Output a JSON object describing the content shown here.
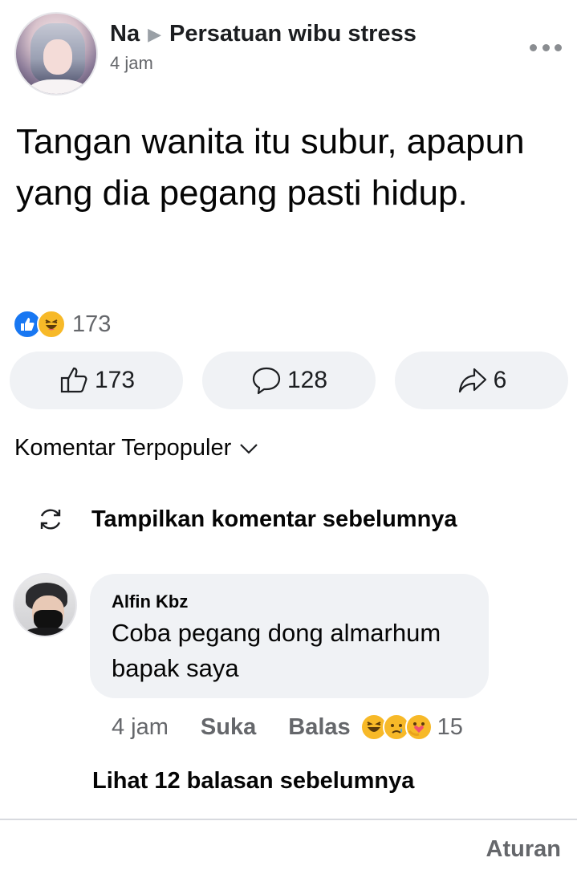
{
  "post": {
    "author": "Na",
    "group": "Persatuan wibu stress",
    "time": "4 jam",
    "text": "Tangan wanita itu subur, apapun yang dia pegang pasti hidup."
  },
  "reactions": {
    "icons": [
      "like-icon",
      "haha-icon"
    ],
    "total": "173"
  },
  "actions": {
    "like_count": "173",
    "comment_count": "128",
    "share_count": "6"
  },
  "comments": {
    "sort_label": "Komentar Terpopuler",
    "previous_label": "Tampilkan komentar sebelumnya",
    "items": [
      {
        "author": "Alfin Kbz",
        "text": "Coba pegang dong almarhum bapak saya",
        "time": "4 jam",
        "like_label": "Suka",
        "reply_label": "Balas",
        "reaction_icons": [
          "haha-icon",
          "sad-icon",
          "care-icon"
        ],
        "reaction_count": "15"
      }
    ],
    "more_replies_label": "Lihat 12 balasan sebelumnya"
  },
  "footer": {
    "rules_label": "Aturan"
  },
  "colors": {
    "like_blue": "#1877f2",
    "emoji_yellow": "#f7b928",
    "button_bg": "#f0f2f5",
    "secondary_text": "#65676b"
  }
}
